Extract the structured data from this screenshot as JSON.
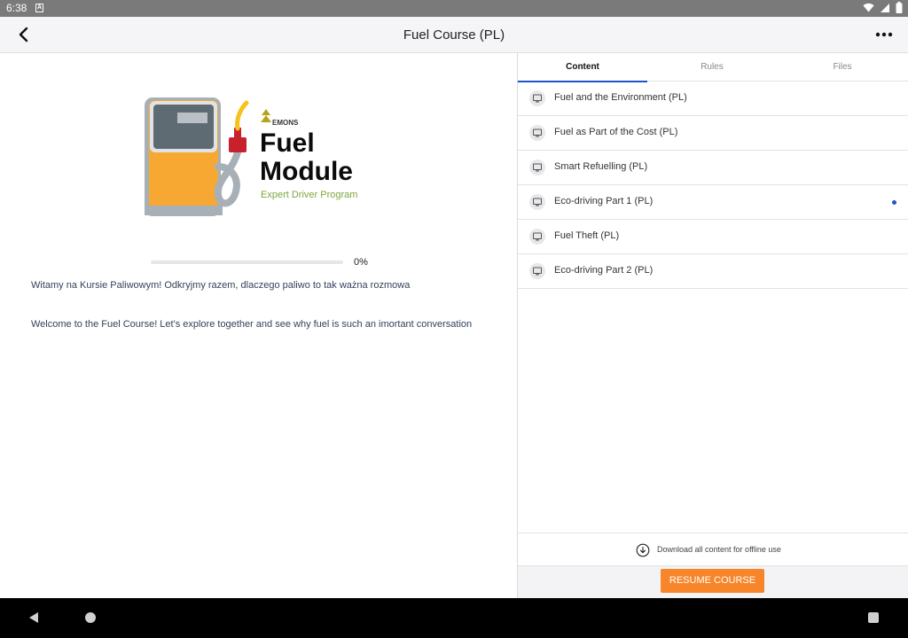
{
  "status_bar": {
    "time": "6:38",
    "notification_icon": "A"
  },
  "app_bar": {
    "title": "Fuel Course (PL)",
    "back_icon": "chevron-left-icon",
    "more_icon": "more-horizontal-icon"
  },
  "logo": {
    "brand": "EMONS",
    "title_line1": "Fuel",
    "title_line2": "Module",
    "subtitle": "Expert Driver Program",
    "colors": {
      "pump_orange": "#f7a833",
      "pump_gray": "#a7b0b7",
      "screen_dark": "#5f6b73",
      "nozzle_red": "#c8202d",
      "subtitle_green": "#7ea63c",
      "brand_yellow": "#b9a21a"
    }
  },
  "progress": {
    "value": 0,
    "label": "0%"
  },
  "intro": {
    "pl": "Witamy na Kursie Paliwowym! Odkryjmy razem, dlaczego paliwo to tak ważna rozmowa",
    "en": "Welcome to the Fuel Course! Let's explore together and see why fuel is such an imortant conversation"
  },
  "tabs": [
    {
      "label": "Content",
      "active": true
    },
    {
      "label": "Rules",
      "active": false
    },
    {
      "label": "Files",
      "active": false
    }
  ],
  "lessons": [
    {
      "label": "Fuel and the Environment (PL)",
      "icon": "monitor-icon",
      "indicator": false
    },
    {
      "label": "Fuel as Part of the Cost (PL)",
      "icon": "monitor-icon",
      "indicator": false
    },
    {
      "label": "Smart Refuelling (PL)",
      "icon": "monitor-icon",
      "indicator": false
    },
    {
      "label": "Eco-driving Part 1 (PL)",
      "icon": "monitor-icon",
      "indicator": true
    },
    {
      "label": "Fuel Theft (PL)",
      "icon": "monitor-icon",
      "indicator": false
    },
    {
      "label": "Eco-driving Part 2 (PL)",
      "icon": "monitor-icon",
      "indicator": false
    }
  ],
  "download": {
    "label": "Download all content for offline use",
    "icon": "download-circle-icon"
  },
  "resume_button": {
    "label": "RESUME COURSE",
    "color": "#f7862a"
  },
  "accent_color": "#1a56c6"
}
